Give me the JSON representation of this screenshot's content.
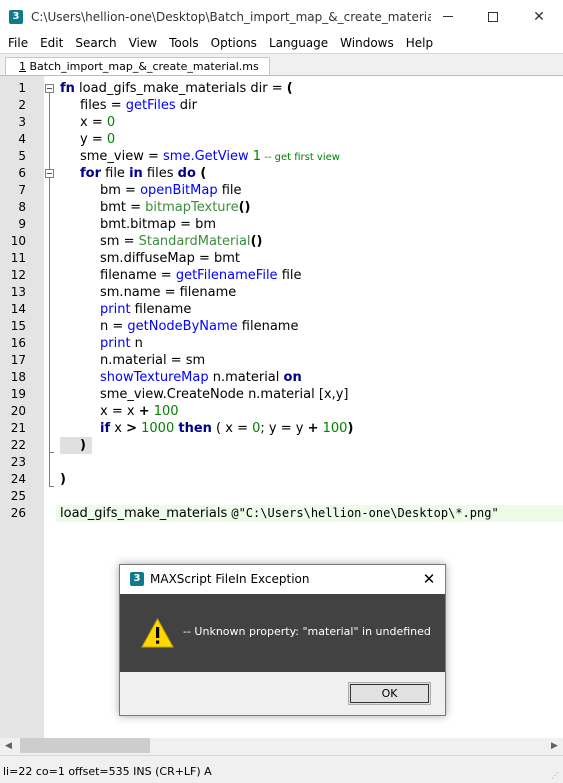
{
  "window": {
    "title": "C:\\Users\\hellion-one\\Desktop\\Batch_import_map_&_create_material.ms...",
    "app_icon_glyph": "3",
    "minimize_glyph": "minimize",
    "maximize_glyph": "maximize",
    "close_glyph": "✕"
  },
  "menu": [
    "File",
    "Edit",
    "Search",
    "View",
    "Tools",
    "Options",
    "Language",
    "Windows",
    "Help"
  ],
  "tab": {
    "accel": "1",
    "label": " Batch_import_map_&_create_material.ms"
  },
  "code_lines": [
    {
      "n": "1"
    },
    {
      "n": "2"
    },
    {
      "n": "3"
    },
    {
      "n": "4"
    },
    {
      "n": "5"
    },
    {
      "n": "6"
    },
    {
      "n": "7"
    },
    {
      "n": "8"
    },
    {
      "n": "9"
    },
    {
      "n": "10"
    },
    {
      "n": "11"
    },
    {
      "n": "12"
    },
    {
      "n": "13"
    },
    {
      "n": "14"
    },
    {
      "n": "15"
    },
    {
      "n": "16"
    },
    {
      "n": "17"
    },
    {
      "n": "18"
    },
    {
      "n": "19"
    },
    {
      "n": "20"
    },
    {
      "n": "21"
    },
    {
      "n": "22"
    },
    {
      "n": "23"
    },
    {
      "n": "24"
    },
    {
      "n": "25"
    },
    {
      "n": "26"
    }
  ],
  "code": {
    "l1": {
      "kw": "fn",
      "rest": " load_gifs_make_materials dir = ",
      "paren": "("
    },
    "l2": {
      "a": "files = ",
      "fn": "getFiles",
      "b": " dir"
    },
    "l3": {
      "a": "x = ",
      "num": "0"
    },
    "l4": {
      "a": "y = ",
      "num": "0"
    },
    "l5": {
      "a": "sme_view = ",
      "fn": "sme.GetView",
      "num": " 1",
      "cm": " -- get first view"
    },
    "l6": {
      "kw1": "for",
      "a": " file ",
      "kw2": "in",
      "b": " files ",
      "kw3": "do",
      "paren": " ("
    },
    "l7": {
      "a": "bm = ",
      "fn": "openBitMap",
      "b": " file"
    },
    "l8": {
      "a": "bmt = ",
      "cls": "bitmapTexture",
      "paren": "()"
    },
    "l9": {
      "a": "bmt.bitmap = bm"
    },
    "l10": {
      "a": "sm = ",
      "cls": "StandardMaterial",
      "paren": "()"
    },
    "l11": {
      "a": "sm.diffuseMap = bmt"
    },
    "l12": {
      "a": "filename = ",
      "fn": "getFilenameFile",
      "b": " file"
    },
    "l13": {
      "a": "sm.name = filename"
    },
    "l14": {
      "fn": "print",
      "b": " filename"
    },
    "l15": {
      "a": "n = ",
      "fn": "getNodeByName",
      "b": " filename"
    },
    "l16": {
      "fn": "print",
      "b": " n"
    },
    "l17": {
      "a": "n.material = sm"
    },
    "l18": {
      "fn": "showTextureMap",
      "b": " n.material ",
      "kw": "on"
    },
    "l19": {
      "a": "sme_view.CreateNode n.material [x,y]"
    },
    "l20": {
      "a": "x = x ",
      "op": "+",
      "num": " 100"
    },
    "l21": {
      "kw1": "if",
      "a": " x ",
      "op": ">",
      "num1": " 1000 ",
      "kw2": "then",
      "b": " ( x = ",
      "num2": "0",
      "c": "; y = y ",
      "op2": "+",
      "num3": " 100",
      "d": ")"
    },
    "l22": {
      "paren": ")"
    },
    "l24": {
      "paren": ")"
    },
    "l26": {
      "a": "load_gifs_make_materials ",
      "str": "@\"C:\\Users\\hellion-one\\Desktop\\*.png\""
    }
  },
  "dialog": {
    "title": "MAXScript FileIn Exception",
    "close_glyph": "✕",
    "message": "-- Unknown property: \"material\" in undefined",
    "ok_label": "OK",
    "icon": "warning-icon"
  },
  "status": {
    "text": "li=22 co=1 offset=535 INS (CR+LF) A"
  },
  "scroll": {
    "left_glyph": "◀",
    "right_glyph": "▶",
    "grip_glyph": "⋰"
  },
  "colors": {
    "keyword": "#00008b",
    "function": "#0000ff",
    "class": "#3c8c3c",
    "number": "#008000",
    "dialog_body": "#424242",
    "warning": "#ffd800"
  }
}
